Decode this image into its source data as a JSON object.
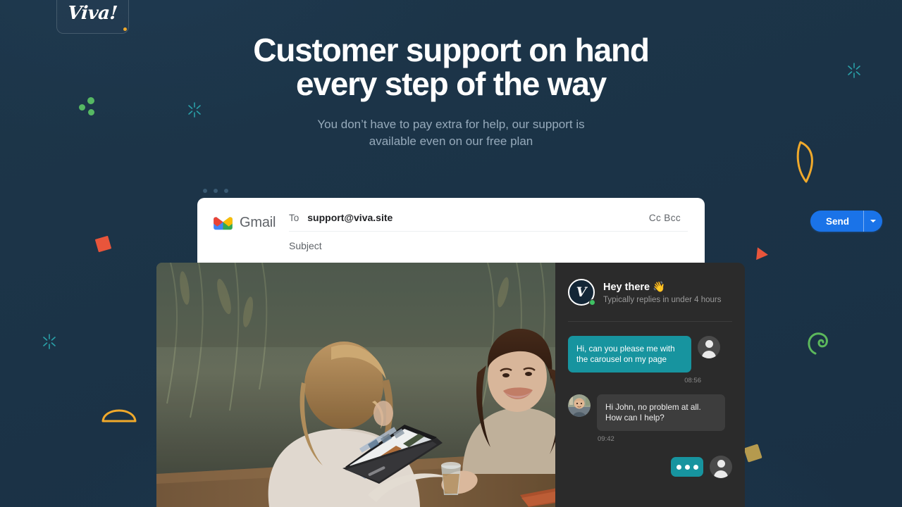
{
  "brand": {
    "logo_text": "Viva!",
    "logo_name": "viva-logo"
  },
  "hero": {
    "headline_line1": "Customer support on hand",
    "headline_line2": "every step of the way",
    "subhead_line1": "You don’t have to pay extra for help, our support is",
    "subhead_line2": "available even on our free plan"
  },
  "gmail": {
    "brand_label": "Gmail",
    "to_label": "To",
    "to_value": "support@viva.site",
    "ccbcc_label": "Cc Bcc",
    "subject_placeholder": "Subject",
    "send_label": "Send",
    "send_caret_icon": "chevron-down-icon",
    "accent_color": "#1a73e8"
  },
  "chat": {
    "title": "Hey there 👋",
    "subtitle": "Typically replies in under 4 hours",
    "avatar_initial": "V",
    "online": true,
    "messages": [
      {
        "id": "m1",
        "side": "visitor",
        "text": "Hi, can you please me with the carousel on my page",
        "time": "08:56",
        "bubble_color": "#17949f",
        "avatar": "visitor-silhouette-avatar"
      },
      {
        "id": "m2",
        "side": "agent",
        "text": "Hi John, no problem at all. How can I help?",
        "time": "09:42",
        "bubble_color": "#3d3d3d",
        "avatar": "agent-photo-avatar"
      },
      {
        "id": "m3",
        "side": "visitor",
        "text": "",
        "time": "",
        "typing": true,
        "bubble_color": "#17949f",
        "avatar": "visitor-silhouette-avatar"
      }
    ]
  },
  "colors": {
    "background": "#1b3347",
    "teal": "#17949f",
    "green": "#56b863",
    "red": "#e8553b",
    "gold": "#f0a92b",
    "panel_dark": "#2b2b2b"
  },
  "decorations": [
    {
      "name": "green-dots-cluster",
      "color": "#56b863"
    },
    {
      "name": "teal-sparkle-left",
      "color": "#2aa0a8"
    },
    {
      "name": "teal-sparkle-right-top",
      "color": "#2aa0a8"
    },
    {
      "name": "teal-sparkle-lower-left",
      "color": "#2aa0a8"
    },
    {
      "name": "red-square",
      "color": "#e8553b"
    },
    {
      "name": "red-triangle",
      "color": "#e8553b"
    },
    {
      "name": "gold-leaf-outline",
      "color": "#f0a92b"
    },
    {
      "name": "gold-dome-outline",
      "color": "#f0a92b"
    },
    {
      "name": "green-spiral",
      "color": "#56b863"
    },
    {
      "name": "gold-square",
      "color": "#b59a4e"
    }
  ]
}
